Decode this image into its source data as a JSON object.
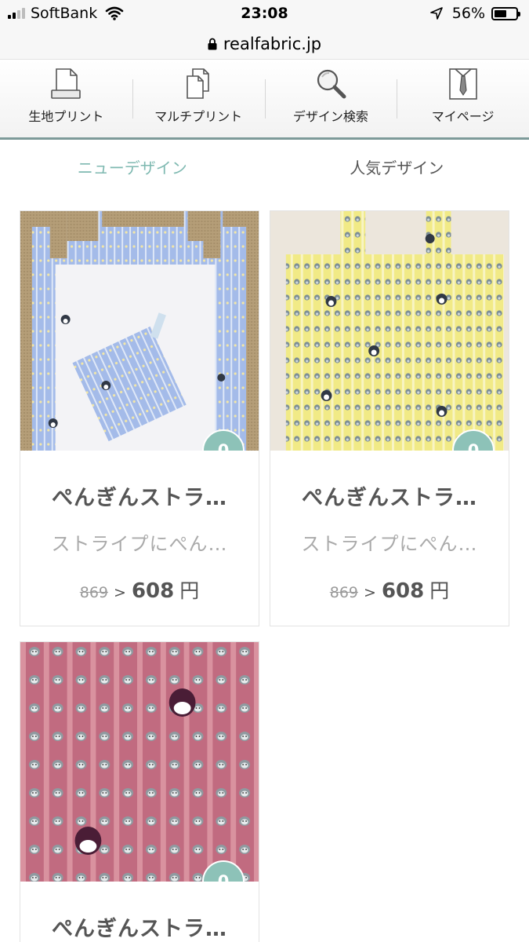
{
  "status_bar": {
    "carrier": "SoftBank",
    "time": "23:08",
    "battery_percent": "56%",
    "battery_level": 0.56,
    "icons": [
      "signal-icon",
      "wifi-icon",
      "location-arrow-icon",
      "battery-icon"
    ]
  },
  "browser": {
    "url": "realfabric.jp",
    "icon": "lock-icon"
  },
  "nav": {
    "items": [
      {
        "label": "生地プリント",
        "icon": "fabric-print-icon"
      },
      {
        "label": "マルチプリント",
        "icon": "multi-print-icon"
      },
      {
        "label": "デザイン検索",
        "icon": "search-icon"
      },
      {
        "label": "マイページ",
        "icon": "shirt-tie-icon"
      }
    ],
    "accent_color": "#7d9a99"
  },
  "tabs": {
    "items": [
      {
        "label": "ニューデザイン",
        "active": true
      },
      {
        "label": "人気デザイン",
        "active": false
      }
    ],
    "active_color": "#7fb9b1"
  },
  "products": [
    {
      "image": "blue-penguin-stripe-tote",
      "likes": "0",
      "title": "ぺんぎんストラ…",
      "description": "ストライプにぺん…",
      "price_old": "869",
      "price_new": "608",
      "currency": "円"
    },
    {
      "image": "yellow-penguin-stripe-tote",
      "likes": "0",
      "title": "ぺんぎんストラ…",
      "description": "ストライプにぺん…",
      "price_old": "869",
      "price_new": "608",
      "currency": "円"
    },
    {
      "image": "pink-penguin-stripe-fabric",
      "likes": "0",
      "title": "ぺんぎんストラ…"
    }
  ],
  "colors": {
    "badge": "#8dc2b8",
    "blue_fabric": "#9eb6e6",
    "yellow_fabric": "#f4ee8a",
    "pink_fabric": "#c26a7f"
  }
}
